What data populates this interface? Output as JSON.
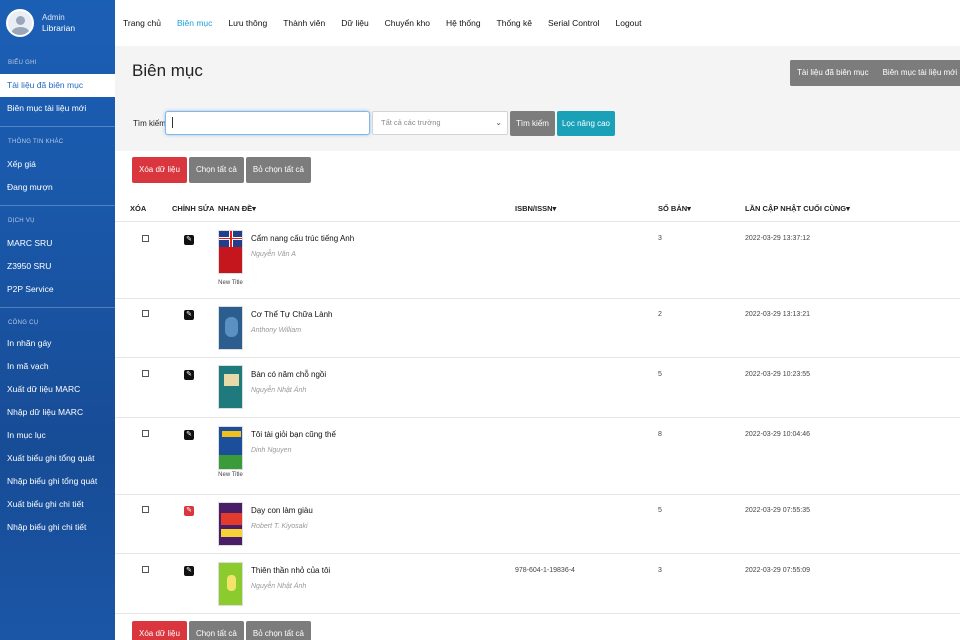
{
  "user": {
    "role": "Admin",
    "name": "Librarian"
  },
  "sidebar": {
    "sections": [
      {
        "title": "BIỂU GHI",
        "items": [
          "Tài liệu đã biên mục",
          "Biên mục tài liệu mới"
        ]
      },
      {
        "title": "THÔNG TIN KHÁC",
        "items": [
          "Xếp giá",
          "Đang mượn"
        ]
      },
      {
        "title": "DỊCH VỤ",
        "items": [
          "MARC SRU",
          "Z3950 SRU",
          "P2P Service"
        ]
      },
      {
        "title": "CÔNG CỤ",
        "items": [
          "In nhãn gáy",
          "In mã vạch",
          "Xuất dữ liệu MARC",
          "Nhập dữ liệu MARC",
          "In mục lục",
          "Xuất biểu ghi tổng quát",
          "Nhập biểu ghi tổng quát",
          "Xuất biểu ghi chi tiết",
          "Nhập biểu ghi chi tiết"
        ]
      }
    ],
    "active_item": "Tài liệu đã biên mục"
  },
  "topnav": [
    "Trang chủ",
    "Biên mục",
    "Lưu thông",
    "Thành viên",
    "Dữ liệu",
    "Chuyển kho",
    "Hệ thống",
    "Thống kê",
    "Serial Control",
    "Logout"
  ],
  "topnav_active": "Biên mục",
  "page": {
    "title": "Biên mục",
    "actions": [
      "Tài liệu đã biên mục",
      "Biên mục tài liệu mới"
    ]
  },
  "search": {
    "label": "Tìm kiếm",
    "value": "",
    "field_select": "Tất cả các trường",
    "search_button": "Tìm kiếm",
    "advanced_button": "Lọc nâng cao"
  },
  "bulk": {
    "delete": "Xóa dữ liệu",
    "select_all": "Chọn tất cả",
    "deselect_all": "Bỏ chọn tất cả"
  },
  "table": {
    "headers": {
      "delete": "XÓA",
      "edit": "CHỈNH SỬA",
      "title": "NHAN ĐỀ",
      "isbn": "ISBN/ISSN",
      "copies": "SỐ BẢN",
      "updated": "LẦN CẬP NHẬT CUỐI CÙNG"
    },
    "rows": [
      {
        "title": "Cẩm nang cấu trúc tiếng Anh",
        "author": "Nguyễn Văn A",
        "isbn": "",
        "copies": "3",
        "updated": "2022-03-29 13:37:12",
        "cover_label": "New Title",
        "cover_color": "#c4161c"
      },
      {
        "title": "Cơ Thể Tự Chữa Lành",
        "author": "Anthony William",
        "isbn": "",
        "copies": "2",
        "updated": "2022-03-29 13:13:21",
        "cover_label": "",
        "cover_color": "#2c5d8f"
      },
      {
        "title": "Bàn có năm chỗ ngồi",
        "author": "Nguyễn Nhật Ánh",
        "isbn": "",
        "copies": "5",
        "updated": "2022-03-29 10:23:55",
        "cover_label": "",
        "cover_color": "#1f7a7e"
      },
      {
        "title": "Tôi tài giỏi bạn cũng thế",
        "author": "Dinh Nguyen",
        "isbn": "",
        "copies": "8",
        "updated": "2022-03-29 10:04:46",
        "cover_label": "New Title",
        "cover_color": "#1b4e9b"
      },
      {
        "title": "Dạy con làm giàu",
        "author": "Robert T. Kiyosaki",
        "isbn": "",
        "copies": "5",
        "updated": "2022-03-29 07:55:35",
        "cover_label": "",
        "cover_color": "#6a2a83"
      },
      {
        "title": "Thiên thần nhỏ của tôi",
        "author": "Nguyễn Nhật Ánh",
        "isbn": "978-604-1-19836-4",
        "copies": "3",
        "updated": "2022-03-29 07:55:09",
        "cover_label": "",
        "cover_color": "#8ccb2e"
      }
    ]
  },
  "colors": {
    "sidebar": "#1a57a8",
    "active_nav": "#1aa0d8",
    "danger": "#d9363e",
    "teal": "#1aa1b8",
    "grey": "#7c7c7c"
  },
  "icons": {
    "edit": "pencil-icon",
    "sort": "sort-caret-icon"
  }
}
